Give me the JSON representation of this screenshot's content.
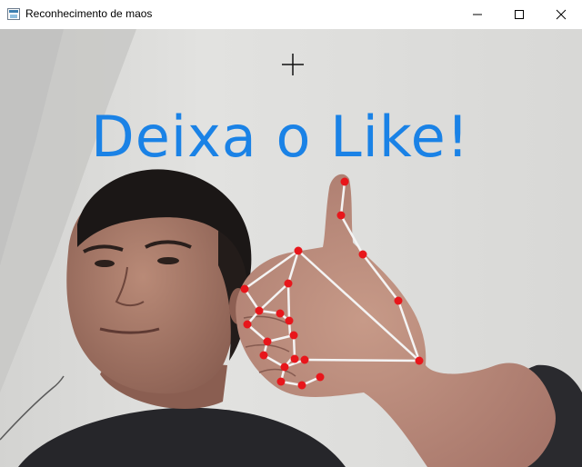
{
  "window": {
    "title": "Reconhecimento de maos",
    "controls": [
      "minimize",
      "maximize",
      "close"
    ]
  },
  "icons": {
    "app": "app-window-icon",
    "minimize": "minimize-icon",
    "maximize": "maximize-icon",
    "close": "close-icon",
    "cursor": "crosshair-cursor-icon"
  },
  "overlay": {
    "text": "Deixa o Like!",
    "color": "#1a82e6"
  },
  "landmarks": {
    "point_color": "#e8161b",
    "line_color": "#f4f4f4"
  }
}
